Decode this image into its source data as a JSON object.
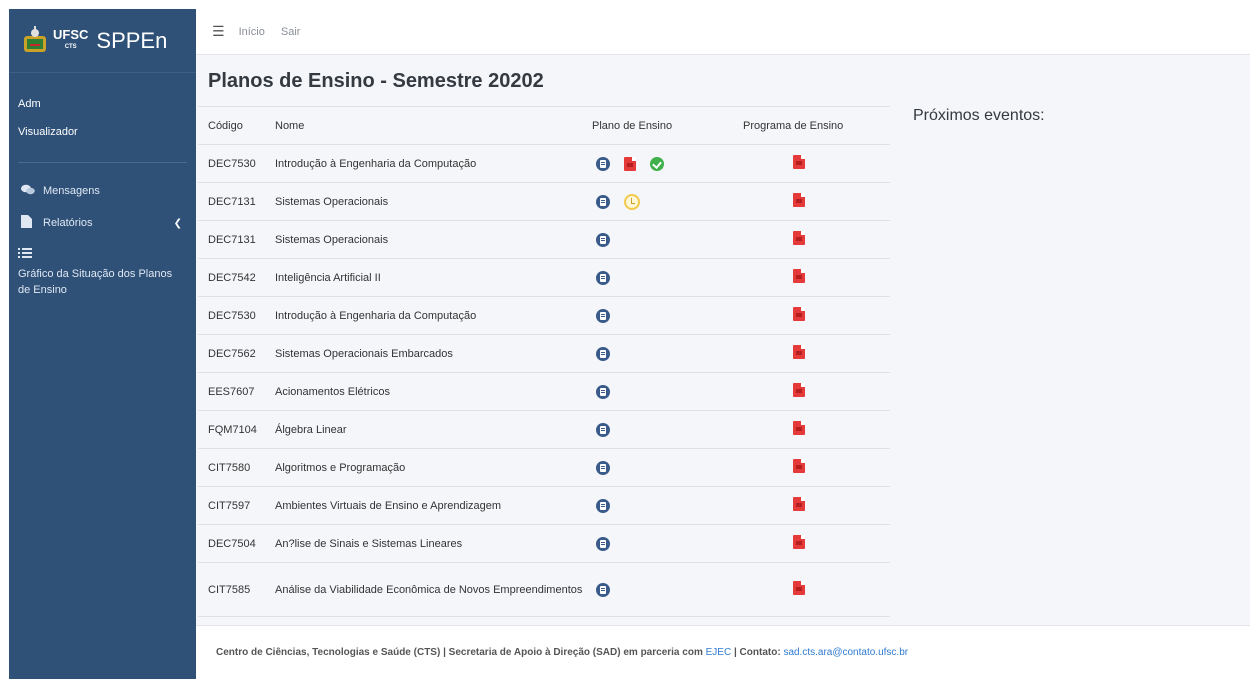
{
  "brand": {
    "ufsc": "UFSC",
    "cts": "CTS",
    "name": "SPPEn"
  },
  "user": {
    "role": "Adm",
    "profile": "Visualizador"
  },
  "sidebar": {
    "items": [
      {
        "label": "Mensagens",
        "icon": "comments-icon"
      },
      {
        "label": "Relatórios",
        "icon": "file-icon"
      },
      {
        "label": "Gráfico da Situação dos Planos de Ensino",
        "icon": "list-icon"
      }
    ]
  },
  "topbar": {
    "home": "Início",
    "logout": "Sair"
  },
  "page": {
    "title": "Planos de Ensino - Semestre 20202",
    "events_title": "Próximos eventos:"
  },
  "table": {
    "headers": [
      "Código",
      "Nome",
      "Plano de Ensino",
      "Programa de Ensino"
    ],
    "rows": [
      {
        "code": "DEC7530",
        "name": "Introdução à Engenharia da Computação",
        "plan_icons": [
          "doc",
          "pdf",
          "check"
        ]
      },
      {
        "code": "DEC7131",
        "name": "Sistemas Operacionais",
        "plan_icons": [
          "doc",
          "clock"
        ]
      },
      {
        "code": "DEC7131",
        "name": "Sistemas Operacionais",
        "plan_icons": [
          "doc"
        ]
      },
      {
        "code": "DEC7542",
        "name": "Inteligência Artificial II",
        "plan_icons": [
          "doc"
        ]
      },
      {
        "code": "DEC7530",
        "name": "Introdução à Engenharia da Computação",
        "plan_icons": [
          "doc"
        ]
      },
      {
        "code": "DEC7562",
        "name": "Sistemas Operacionais Embarcados",
        "plan_icons": [
          "doc"
        ]
      },
      {
        "code": "EES7607",
        "name": "Acionamentos Elétricos",
        "plan_icons": [
          "doc"
        ]
      },
      {
        "code": "FQM7104",
        "name": "Álgebra Linear",
        "plan_icons": [
          "doc"
        ]
      },
      {
        "code": "CIT7580",
        "name": "Algoritmos e Programação",
        "plan_icons": [
          "doc"
        ]
      },
      {
        "code": "CIT7597",
        "name": "Ambientes Virtuais de Ensino e Aprendizagem",
        "plan_icons": [
          "doc"
        ]
      },
      {
        "code": "DEC7504",
        "name": "An?lise de Sinais e Sistemas Lineares",
        "plan_icons": [
          "doc"
        ]
      },
      {
        "code": "CIT7585",
        "name": "Análise da Viabilidade Econômica de Novos Empreendimentos",
        "plan_icons": [
          "doc"
        ]
      }
    ]
  },
  "footer": {
    "text1": "Centro de Ciências, Tecnologias e Saúde (CTS) | Secretaria de Apoio à Direção (SAD) em parceria com",
    "link1": "EJEC",
    "text2": "| Contato:",
    "email": "sad.cts.ara@contato.ufsc.br"
  }
}
